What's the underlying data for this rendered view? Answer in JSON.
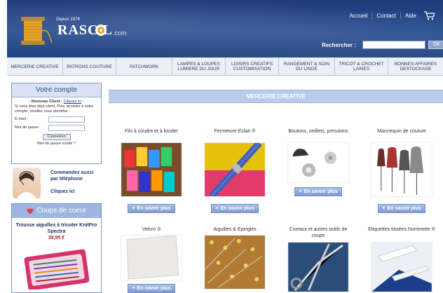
{
  "header": {
    "since": "Depuis 1974",
    "brand": "RASC  L",
    "domain": ".com",
    "links": [
      "Accueil",
      "Contact",
      "Aide"
    ],
    "search_label": "Rechercher :",
    "search_value": "",
    "search_button": "OK",
    "cart_icon": "cart-icon"
  },
  "nav": [
    "MERCERIE CREATIVE",
    "PATRONS COUTURE",
    "PATCHWORK",
    "LAMPES & LOUPES LUMIERE DU JOUR",
    "LOISIRS CREATIFS CUSTOMISATION",
    "RANGEMENT & SOIN DU LINGE",
    "TRICOT & CROCHET LAINES",
    "BONNES AFFAIRES DESTOCKAGE"
  ],
  "account": {
    "title": "Votre compte",
    "new_client_label": "- Nouveau Client - ",
    "new_client_link": "Cliquez ici",
    "new_client_suffix": " -",
    "info": "Si vous êtes déjà client, Pour accéder à votre compte, veuillez vous identifier :",
    "email_label": "E-mail :",
    "password_label": "Mot de passe :",
    "connect_button": "Connexion",
    "forgot": "Mot de passe oublié ?"
  },
  "phone": {
    "text": "Commandez aussi par téléphone",
    "cta": "Cliquez ici"
  },
  "favorites": {
    "title": "Coups de coeur",
    "product": "Trousse aiguilles à tricoter KnitPro Spectra",
    "price": "39,95 €"
  },
  "main": {
    "section_title": "MERCERIE CREATIVE",
    "more_label": "En savoir plus",
    "products": [
      {
        "title": "Fils à coudre et à broder"
      },
      {
        "title": "Fermeture Eclair ®"
      },
      {
        "title": "Boutons, oeillets, pressions"
      },
      {
        "title": "Mannequin de couture"
      },
      {
        "title": "Velcro ®"
      },
      {
        "title": "Aiguilles & Epingles"
      },
      {
        "title": "Ciseaux et autres outils de coupe"
      },
      {
        "title": "Etiquettes tissées Nominette ®"
      }
    ]
  }
}
